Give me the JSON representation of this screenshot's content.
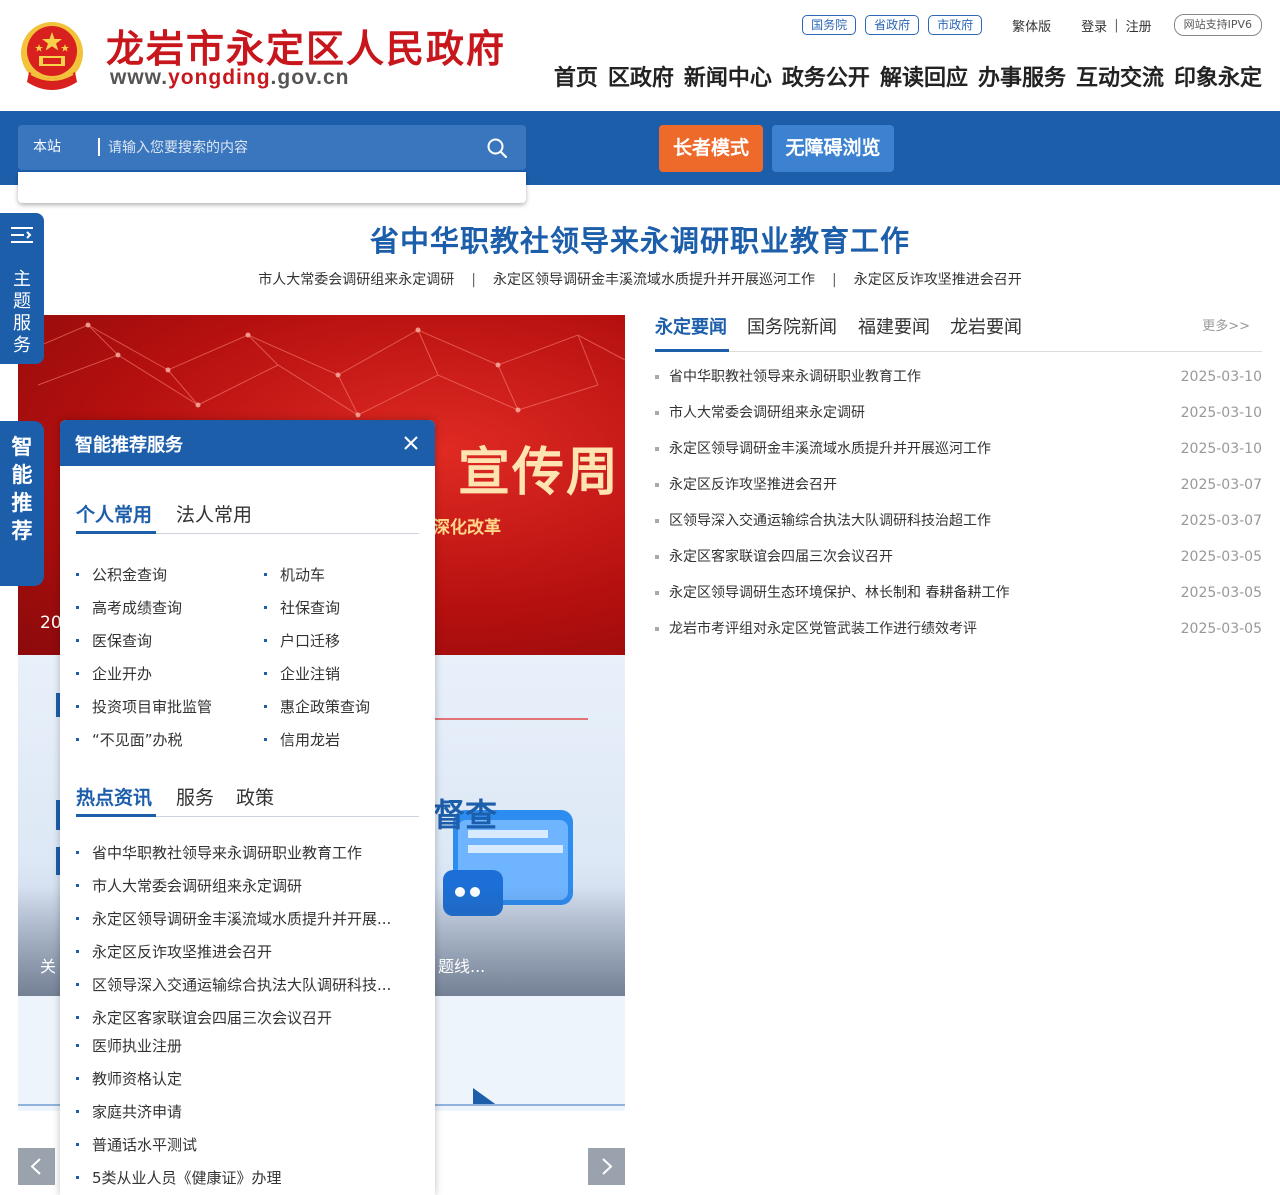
{
  "header": {
    "title": "龙岩市永定区人民政府",
    "domain_prefix": "www.",
    "domain_highlight": "yongding",
    "domain_suffix": ".gov.cn",
    "top_links": {
      "state_council": "国务院",
      "province_gov": "省政府",
      "city_gov": "市政府",
      "traditional": "繁体版",
      "login": "登录",
      "separator": "|",
      "register": "注册",
      "ipv6": "网站支持IPV6"
    },
    "nav": [
      "首页",
      "区政府",
      "新闻中心",
      "政务公开",
      "解读回应",
      "办事服务",
      "互动交流",
      "印象永定"
    ]
  },
  "search": {
    "scope": "本站",
    "placeholder": "请输入您要搜索的内容"
  },
  "buttons": {
    "elder_mode": "长者模式",
    "accessible": "无障碍浏览"
  },
  "side_tabs": {
    "theme": [
      "主",
      "题",
      "服",
      "务"
    ],
    "smart": [
      "智",
      "能",
      "推",
      "荐"
    ]
  },
  "headline": {
    "title": "省中华职教社领导来永调研职业教育工作",
    "subs": [
      "市人大常委会调研组来永定调研",
      "永定区领导调研金丰溪流域水质提升并开展巡河工作",
      "永定区反诈攻坚推进会召开"
    ],
    "separator": "|"
  },
  "carousel": {
    "slide1_title": "宣传周",
    "slide1_sub": "深化改革",
    "slide1_caption": "20",
    "slide2_title": "督查",
    "slide2_caption": "题线...",
    "slide2_left": "关"
  },
  "news": {
    "tabs": [
      "永定要闻",
      "国务院新闻",
      "福建要闻",
      "龙岩要闻"
    ],
    "more": "更多>>",
    "items": [
      {
        "title": "省中华职教社领导来永调研职业教育工作",
        "date": "2025-03-10"
      },
      {
        "title": "市人大常委会调研组来永定调研",
        "date": "2025-03-10"
      },
      {
        "title": "永定区领导调研金丰溪流域水质提升并开展巡河工作",
        "date": "2025-03-10"
      },
      {
        "title": "永定区反诈攻坚推进会召开",
        "date": "2025-03-07"
      },
      {
        "title": "区领导深入交通运输综合执法大队调研科技治超工作",
        "date": "2025-03-07"
      },
      {
        "title": "永定区客家联谊会四届三次会议召开",
        "date": "2025-03-05"
      },
      {
        "title": "永定区领导调研生态环境保护、林长制和 春耕备耕工作",
        "date": "2025-03-05"
      },
      {
        "title": "龙岩市考评组对永定区党管武装工作进行绩效考评",
        "date": "2025-03-05"
      }
    ]
  },
  "popup": {
    "title": "智能推荐服务",
    "tabs1": [
      "个人常用",
      "法人常用"
    ],
    "services_left": [
      "公积金查询",
      "高考成绩查询",
      "医保查询",
      "企业开办",
      "投资项目审批监管",
      "“不见面”办税"
    ],
    "services_right": [
      "机动车",
      "社保查询",
      "户口迁移",
      "企业注销",
      "惠企政策查询",
      "信用龙岩"
    ],
    "tabs2": [
      "热点资讯",
      "服务",
      "政策"
    ],
    "hot_items": [
      "省中华职教社领导来永调研职业教育工作",
      "市人大常委会调研组来永定调研",
      "永定区领导调研金丰溪流域水质提升并开展...",
      "永定区反诈攻坚推进会召开",
      "区领导深入交通运输综合执法大队调研科技...",
      "永定区客家联谊会四届三次会议召开",
      "医师执业注册",
      "教师资格认定",
      "家庭共济申请",
      "普通话水平测试",
      "5类从业人员《健康证》办理"
    ]
  },
  "colors": {
    "primary_blue": "#1d5eab",
    "title_red": "#c8161d",
    "elder_orange": "#ee6a2b",
    "access_blue": "#3d82d0"
  }
}
